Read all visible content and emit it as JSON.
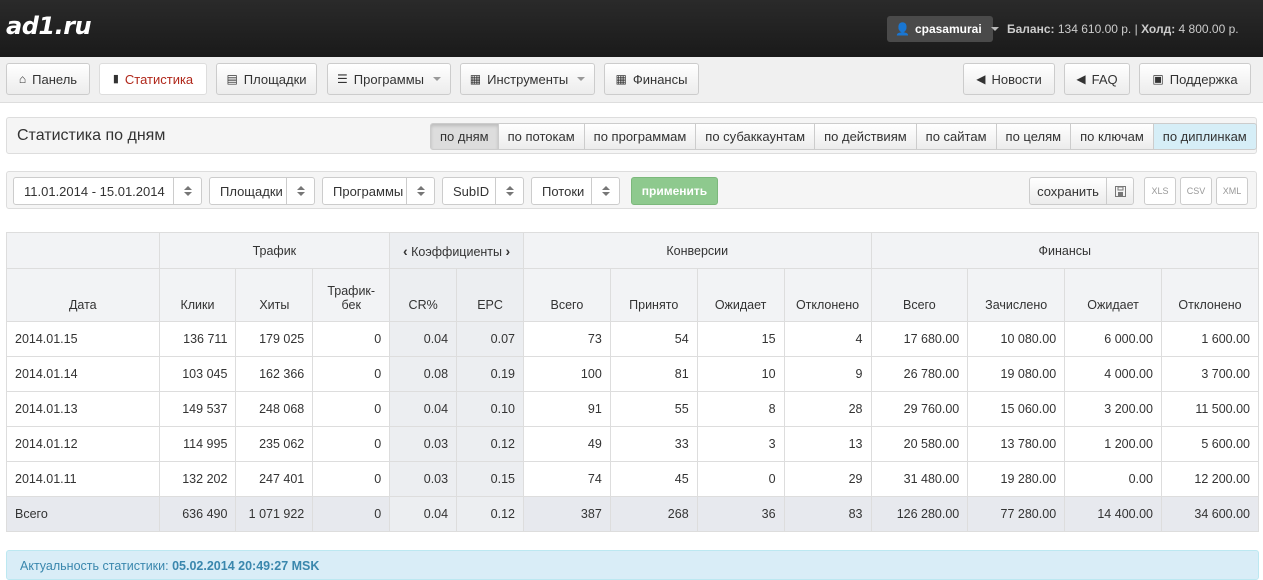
{
  "header": {
    "logo": "ad1.ru",
    "user": "cpasamurai",
    "balance_label": "Баланс:",
    "balance_value": "134 610.00 р.",
    "separator": "|",
    "hold_label": "Холд:",
    "hold_value": "4 800.00 р."
  },
  "nav": {
    "panel": "Панель",
    "stats": "Статистика",
    "sites": "Площадки",
    "programs": "Программы",
    "tools": "Инструменты",
    "finance": "Финансы",
    "news": "Новости",
    "faq": "FAQ",
    "support": "Поддержка"
  },
  "page": {
    "title": "Статистика по дням",
    "groupings": [
      "по дням",
      "по потокам",
      "по программам",
      "по субаккаунтам",
      "по действиям",
      "по сайтам",
      "по целям",
      "по ключам",
      "по диплинкам"
    ],
    "active_grouping": "по дням"
  },
  "filters": {
    "date_range": "11.01.2014 - 15.01.2014",
    "sites": "Площадки",
    "programs": "Программы",
    "subid": "SubID",
    "streams": "Потоки",
    "apply": "применить",
    "save": "сохранить",
    "export_xls": "XLS",
    "export_csv": "CSV",
    "export_xml": "XML"
  },
  "table": {
    "groups": {
      "traffic": "Трафик",
      "coefficients": "Коэффициенты",
      "conversions": "Конверсии",
      "finance": "Финансы"
    },
    "columns": [
      "Дата",
      "Клики",
      "Хиты",
      "Трафик-бек",
      "CR%",
      "EPC",
      "Всего",
      "Принято",
      "Ожидает",
      "Отклонено",
      "Всего",
      "Зачислено",
      "Ожидает",
      "Отклонено"
    ],
    "rows": [
      [
        "2014.01.15",
        "136 711",
        "179 025",
        "0",
        "0.04",
        "0.07",
        "73",
        "54",
        "15",
        "4",
        "17 680.00",
        "10 080.00",
        "6 000.00",
        "1 600.00"
      ],
      [
        "2014.01.14",
        "103 045",
        "162 366",
        "0",
        "0.08",
        "0.19",
        "100",
        "81",
        "10",
        "9",
        "26 780.00",
        "19 080.00",
        "4 000.00",
        "3 700.00"
      ],
      [
        "2014.01.13",
        "149 537",
        "248 068",
        "0",
        "0.04",
        "0.10",
        "91",
        "55",
        "8",
        "28",
        "29 760.00",
        "15 060.00",
        "3 200.00",
        "11 500.00"
      ],
      [
        "2014.01.12",
        "114 995",
        "235 062",
        "0",
        "0.03",
        "0.12",
        "49",
        "33",
        "3",
        "13",
        "20 580.00",
        "13 780.00",
        "1 200.00",
        "5 600.00"
      ],
      [
        "2014.01.11",
        "132 202",
        "247 401",
        "0",
        "0.03",
        "0.15",
        "74",
        "45",
        "0",
        "29",
        "31 480.00",
        "19 280.00",
        "0.00",
        "12 200.00"
      ]
    ],
    "total": [
      "Всего",
      "636 490",
      "1 071 922",
      "0",
      "0.04",
      "0.12",
      "387",
      "268",
      "36",
      "83",
      "126 280.00",
      "77 280.00",
      "14 400.00",
      "34 600.00"
    ]
  },
  "footer": {
    "label": "Актуальность статистики:",
    "value": "05.02.2014 20:49:27 MSK"
  }
}
